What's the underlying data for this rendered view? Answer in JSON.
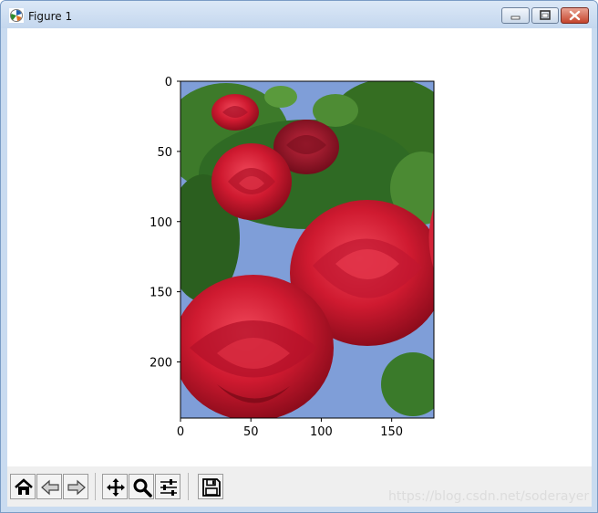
{
  "window": {
    "title": "Figure 1",
    "icons": {
      "app": "matplotlib-figure-icon",
      "minimize": "minimize-icon",
      "maximize": "maximize-icon",
      "close": "close-icon"
    }
  },
  "plot": {
    "image_subject": "red roses photo",
    "x_ticks": [
      "0",
      "50",
      "100",
      "150"
    ],
    "y_ticks": [
      "0",
      "50",
      "100",
      "150",
      "200"
    ],
    "xlim": [
      0,
      180
    ],
    "ylim": [
      240,
      0
    ]
  },
  "toolbar": {
    "buttons": [
      {
        "name": "home-button",
        "icon": "home-icon"
      },
      {
        "name": "back-button",
        "icon": "arrow-left-icon"
      },
      {
        "name": "forward-button",
        "icon": "arrow-right-icon"
      },
      {
        "name": "pan-button",
        "icon": "move-icon"
      },
      {
        "name": "zoom-button",
        "icon": "zoom-icon"
      },
      {
        "name": "configure-subplots-button",
        "icon": "sliders-icon"
      },
      {
        "name": "save-button",
        "icon": "save-icon"
      }
    ]
  },
  "watermark": "https://blog.csdn.net/soderayer",
  "colors": {
    "window_frame": "#c9dbf0",
    "close_button": "#c5442c",
    "sky": "#7f9ed8",
    "rose": "#c8172b",
    "leaf": "#2f6a24"
  }
}
